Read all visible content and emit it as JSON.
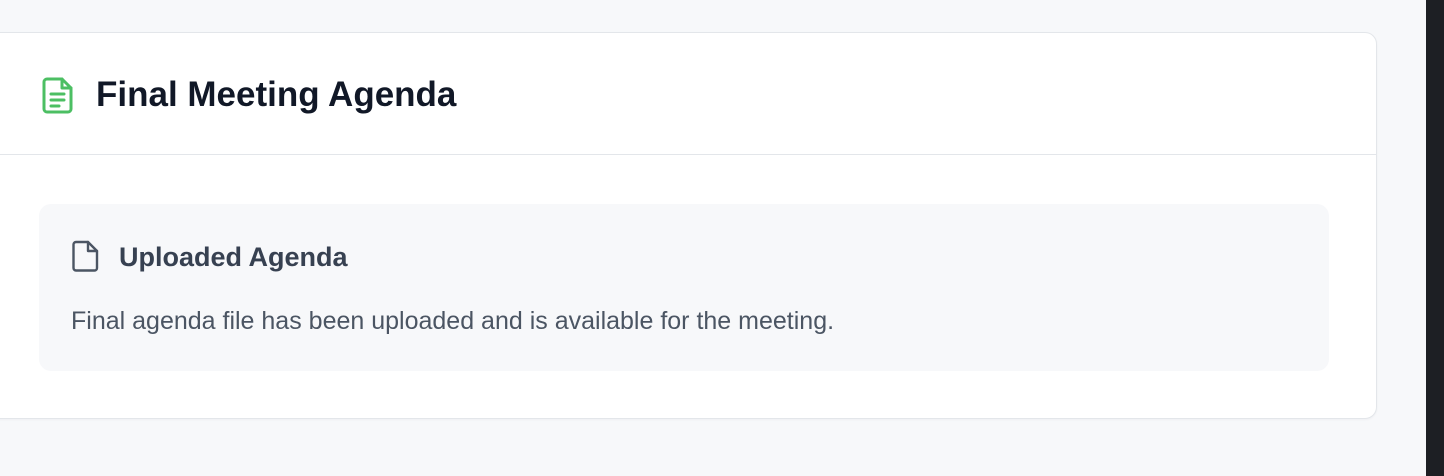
{
  "card": {
    "title": "Final Meeting Agenda",
    "title_icon": "document-text-icon",
    "accent_color": "#4cbf63"
  },
  "section": {
    "title": "Uploaded Agenda",
    "title_icon": "document-icon",
    "description": "Final agenda file has been uploaded and is available for the meeting."
  }
}
